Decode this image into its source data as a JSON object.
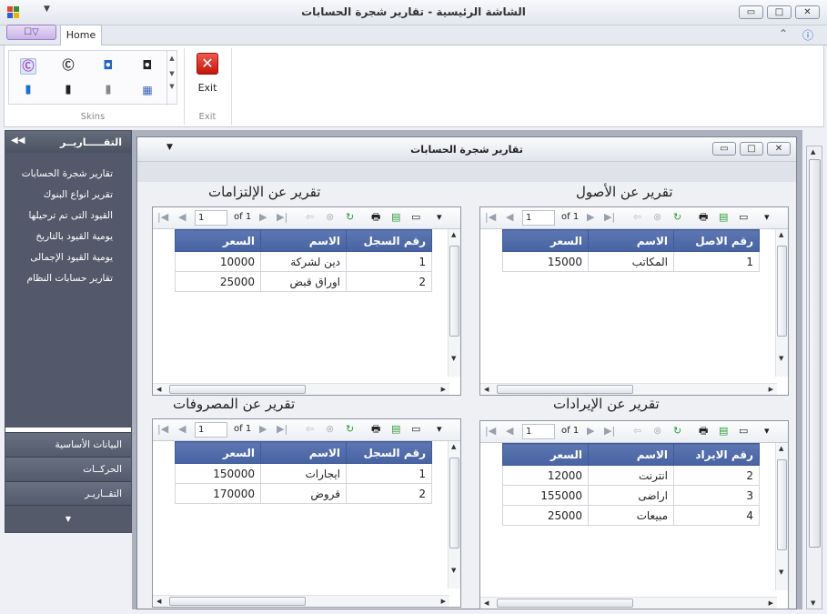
{
  "window": {
    "title": "الشاشة الرئيسية - تقارير شجرة الحسابات",
    "controls": {
      "minimize": "▭",
      "maximize": "□",
      "close": "✕"
    }
  },
  "ribbon": {
    "tabs": [
      {
        "label": "Home"
      }
    ],
    "groups": {
      "skins_label": "Skins",
      "exit_label": "Exit"
    },
    "exit_button": "Exit",
    "skins": [
      "office-2007-pink",
      "office-2007-black",
      "office-2016-blue",
      "office-2016-black",
      "office-2019-colorful",
      "office-2019-black",
      "office-2019-white",
      "dev-express-style"
    ]
  },
  "nav": {
    "header": "التقـــــاريــر",
    "items": [
      {
        "label": "تقارير شجرة الحسابات"
      },
      {
        "label": "تقرير انواع البنوك"
      },
      {
        "label": "القيود التى تم ترحيلها"
      },
      {
        "label": "يومية القيود بالتاريخ"
      },
      {
        "label": "يومية القيود الإجمالى"
      },
      {
        "label": "تقارير حسابات النظام"
      }
    ],
    "groups": [
      {
        "label": "البيانات الأساسية"
      },
      {
        "label": "الحركــات"
      },
      {
        "label": "التقــاريـر"
      }
    ]
  },
  "child_window": {
    "title": "تقارير شجرة الحسابات"
  },
  "reports": [
    {
      "title": "تقرير عن الإلتزامات",
      "page": "1",
      "of": "of 1",
      "headers": [
        "رقم السجل",
        "الاسم",
        "السعر"
      ],
      "rows": [
        [
          "1",
          "دين لشركة",
          "10000"
        ],
        [
          "2",
          "اوراق قبض",
          "25000"
        ]
      ]
    },
    {
      "title": "تقرير عن الأصول",
      "page": "1",
      "of": "of 1",
      "headers": [
        "رقم الاصل",
        "الاسم",
        "السعر"
      ],
      "rows": [
        [
          "1",
          "المكاتب",
          "15000"
        ]
      ]
    },
    {
      "title": "تقرير عن المصروفات",
      "page": "1",
      "of": "of 1",
      "headers": [
        "رقم السجل",
        "الاسم",
        "السعر"
      ],
      "rows": [
        [
          "1",
          "ايجارات",
          "150000"
        ],
        [
          "2",
          "قروض",
          "170000"
        ]
      ]
    },
    {
      "title": "تقرير عن الإيرادات",
      "page": "1",
      "of": "of 1",
      "headers": [
        "رقم الايراد",
        "الاسم",
        "السعر"
      ],
      "rows": [
        [
          "2",
          "انترنت",
          "12000"
        ],
        [
          "3",
          "اراضى",
          "155000"
        ],
        [
          "4",
          "مبيعات",
          "25000"
        ]
      ]
    }
  ]
}
